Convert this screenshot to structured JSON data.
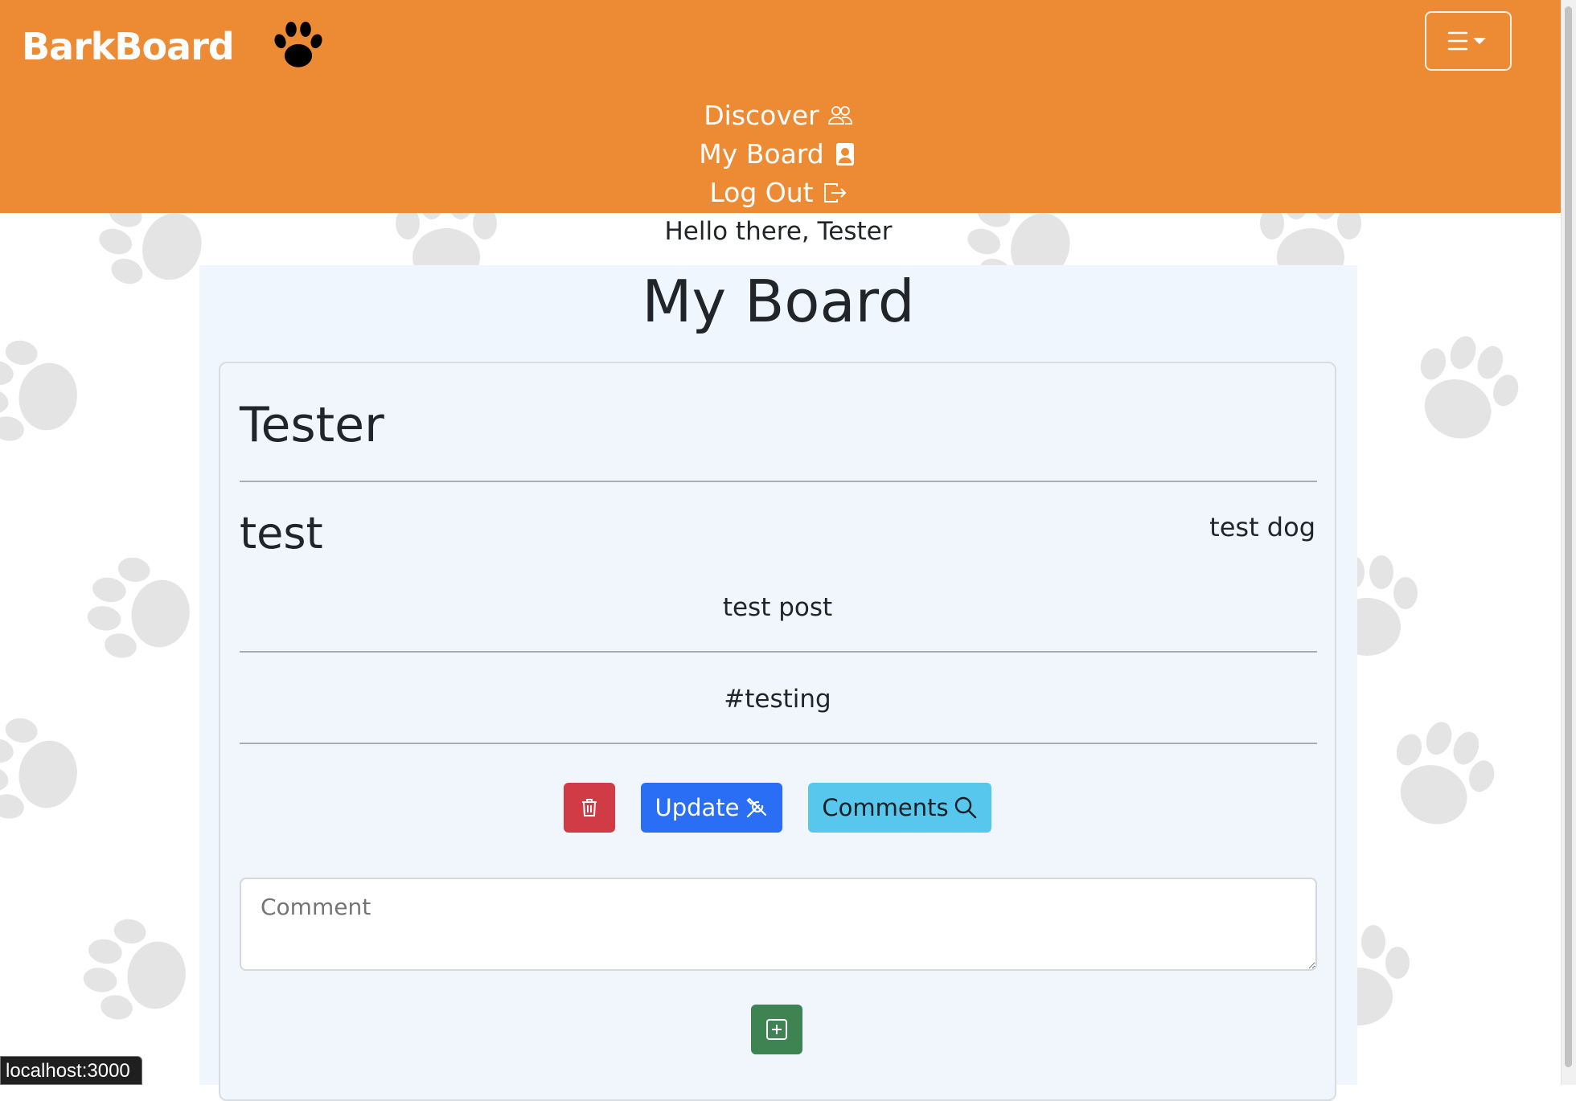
{
  "navbar": {
    "brand": "BarkBoard",
    "brand_icon": "paw-icon",
    "toggler_icon": "hamburger-menu-icon",
    "links": [
      {
        "label": "Discover",
        "icon": "people-icon"
      },
      {
        "label": "My Board",
        "icon": "person-badge-icon"
      },
      {
        "label": "Log Out",
        "icon": "box-arrow-right-icon"
      }
    ],
    "accent_color": "#ed8b35"
  },
  "greeting": "Hello there, Tester",
  "board": {
    "title": "My Board",
    "owner": "Tester",
    "post": {
      "title": "test",
      "dog": "test dog",
      "body": "test post",
      "tags": "#testing"
    },
    "actions": {
      "delete_icon": "trash-icon",
      "update_label": "Update",
      "update_icon": "tools-icon",
      "comments_label": "Comments",
      "comments_icon": "search-icon"
    },
    "comment_placeholder": "Comment",
    "add_icon": "plus-square-icon"
  },
  "status_bar": {
    "url": "localhost:3000"
  }
}
